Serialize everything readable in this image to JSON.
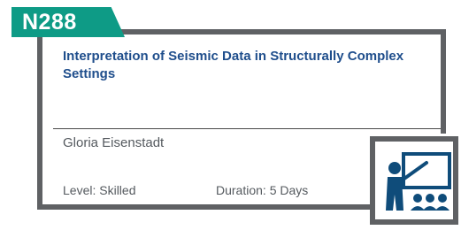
{
  "course": {
    "code": "N288",
    "title": "Interpretation of Seismic Data in Structurally Complex Settings",
    "instructor": "Gloria Eisenstadt",
    "level": "Level: Skilled",
    "duration": "Duration: 5 Days"
  },
  "colors": {
    "accent": "#0e9b86",
    "title": "#1f4e8c",
    "border": "#5f6164",
    "icon": "#0f4c7a"
  },
  "icons": [
    "presentation-icon"
  ]
}
